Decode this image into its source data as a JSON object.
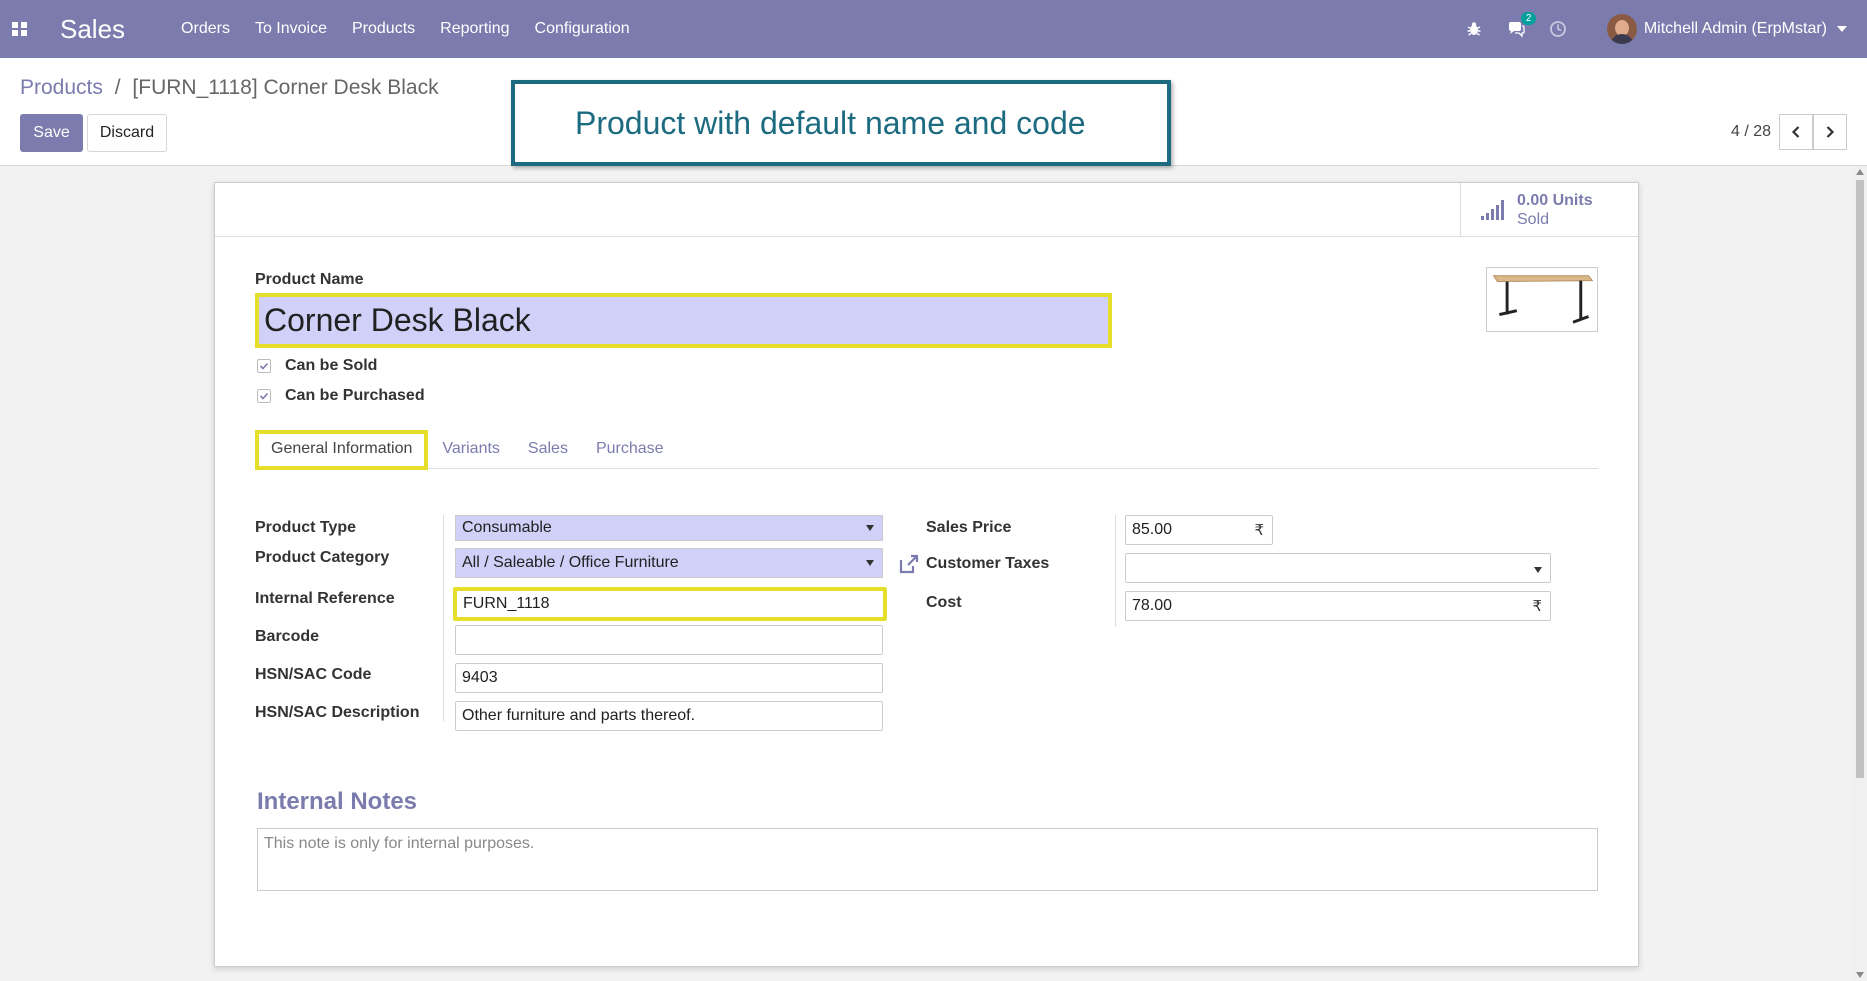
{
  "navbar": {
    "app_title": "Sales",
    "menu": [
      "Orders",
      "To Invoice",
      "Products",
      "Reporting",
      "Configuration"
    ],
    "message_count": "2",
    "user_name": "Mitchell Admin (ErpMstar)"
  },
  "breadcrumb": {
    "parent": "Products",
    "separator": "/",
    "current": "[FURN_1118] Corner Desk Black"
  },
  "actions": {
    "save": "Save",
    "discard": "Discard"
  },
  "pager": {
    "value": "4 / 28"
  },
  "callout": {
    "text": "Product with default name and code"
  },
  "stat_button": {
    "value": "0.00 Units",
    "label": "Sold"
  },
  "product": {
    "name_label": "Product Name",
    "name": "Corner Desk Black",
    "can_be_sold": "Can be Sold",
    "can_be_purchased": "Can be Purchased"
  },
  "tabs": [
    "General Information",
    "Variants",
    "Sales",
    "Purchase"
  ],
  "fields": {
    "product_type": {
      "label": "Product Type",
      "value": "Consumable"
    },
    "product_category": {
      "label": "Product Category",
      "value": "All / Saleable / Office Furniture"
    },
    "internal_reference": {
      "label": "Internal Reference",
      "value": "FURN_1118"
    },
    "barcode": {
      "label": "Barcode",
      "value": ""
    },
    "hsn_code": {
      "label": "HSN/SAC Code",
      "value": "9403"
    },
    "hsn_description": {
      "label": "HSN/SAC Description",
      "value": "Other furniture and parts thereof."
    },
    "sales_price": {
      "label": "Sales Price",
      "value": "85.00",
      "currency": "₹"
    },
    "customer_taxes": {
      "label": "Customer Taxes",
      "value": ""
    },
    "cost": {
      "label": "Cost",
      "value": "78.00",
      "currency": "₹"
    }
  },
  "notes": {
    "title": "Internal Notes",
    "text": "This note is only for internal purposes."
  },
  "colors": {
    "brand": "#7c7bad",
    "highlight": "#e6df2a",
    "callout": "#1c6b80"
  }
}
